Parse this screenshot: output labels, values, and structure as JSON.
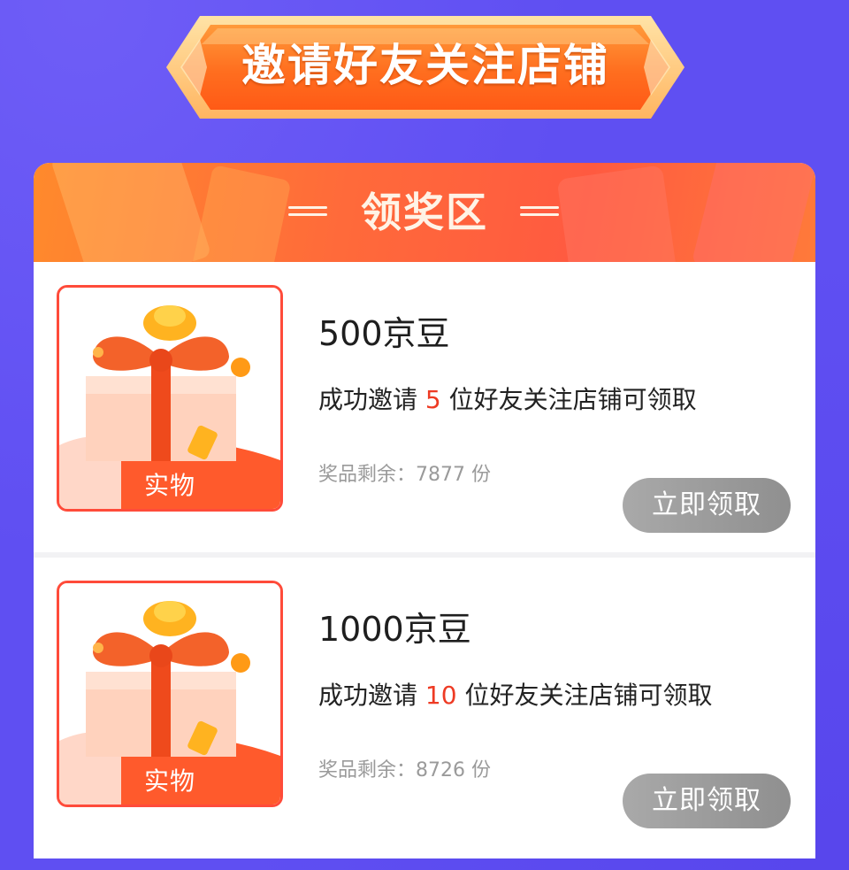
{
  "banner": {
    "title": "邀请好友关注店铺"
  },
  "section": {
    "title": "领奖区"
  },
  "prizes": [
    {
      "name": "500京豆",
      "desc_prefix": "成功邀请 ",
      "count": "5",
      "desc_suffix": " 位好友关注店铺可领取",
      "stock_label": "奖品剩余：",
      "stock_value": "7877",
      "stock_unit": " 份",
      "tag": "实物",
      "button": "立即领取"
    },
    {
      "name": "1000京豆",
      "desc_prefix": "成功邀请 ",
      "count": "10",
      "desc_suffix": " 位好友关注店铺可领取",
      "stock_label": "奖品剩余：",
      "stock_value": "8726",
      "stock_unit": " 份",
      "tag": "实物",
      "button": "立即领取"
    }
  ],
  "colors": {
    "background": "#5f4ff2",
    "accent_orange": "#ff6a3a",
    "highlight_red": "#ee3b24",
    "button_gray": "#9c9c9c"
  },
  "icons": {
    "gift": "gift-box-icon",
    "gold": "gold-ingot-icon"
  }
}
